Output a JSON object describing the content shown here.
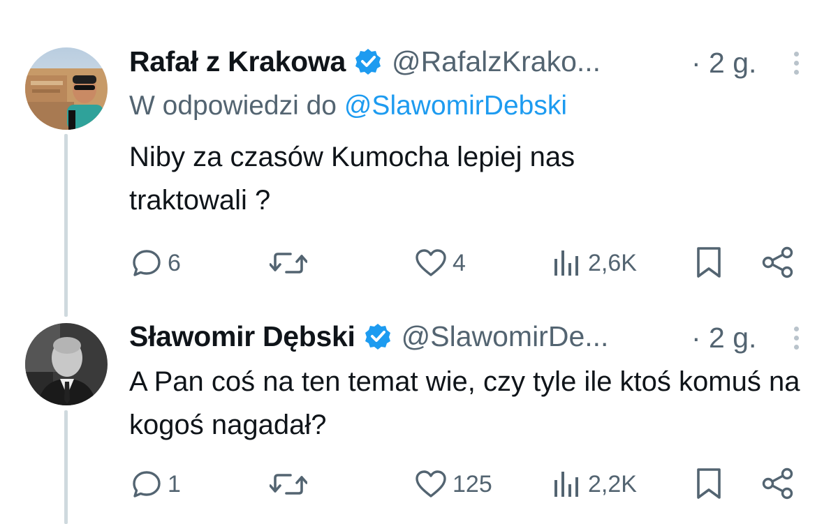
{
  "tweets": [
    {
      "name": "Rafał z Krakowa",
      "handle": "@RafalzKrako...",
      "time": "· 2 g.",
      "reply_to_prefix": "W odpowiedzi do",
      "reply_to_handle": "@SlawomirDebski",
      "text": "Niby za czasów Kumocha lepiej nas traktowali ?",
      "replies": "6",
      "retweets": "",
      "likes": "4",
      "views": "2,6K"
    },
    {
      "name": "Sławomir Dębski",
      "handle": "@SlawomirDe...",
      "time": "· 2 g.",
      "text": "A Pan coś na ten temat wie, czy tyle ile ktoś komuś na kogoś nagadał?",
      "replies": "1",
      "retweets": "",
      "likes": "125",
      "views": "2,2K"
    }
  ],
  "icons": {
    "reply": "speech-bubble-icon",
    "retweet": "retweet-icon",
    "like": "heart-icon",
    "views": "bar-chart-icon",
    "bookmark": "bookmark-icon",
    "share": "share-icon",
    "verified": "verified-badge-icon",
    "more": "more-options-icon"
  },
  "colors": {
    "text": "#0f1419",
    "secondary": "#536471",
    "accent": "#1d9bf0",
    "thread_line": "#cfd9de"
  }
}
